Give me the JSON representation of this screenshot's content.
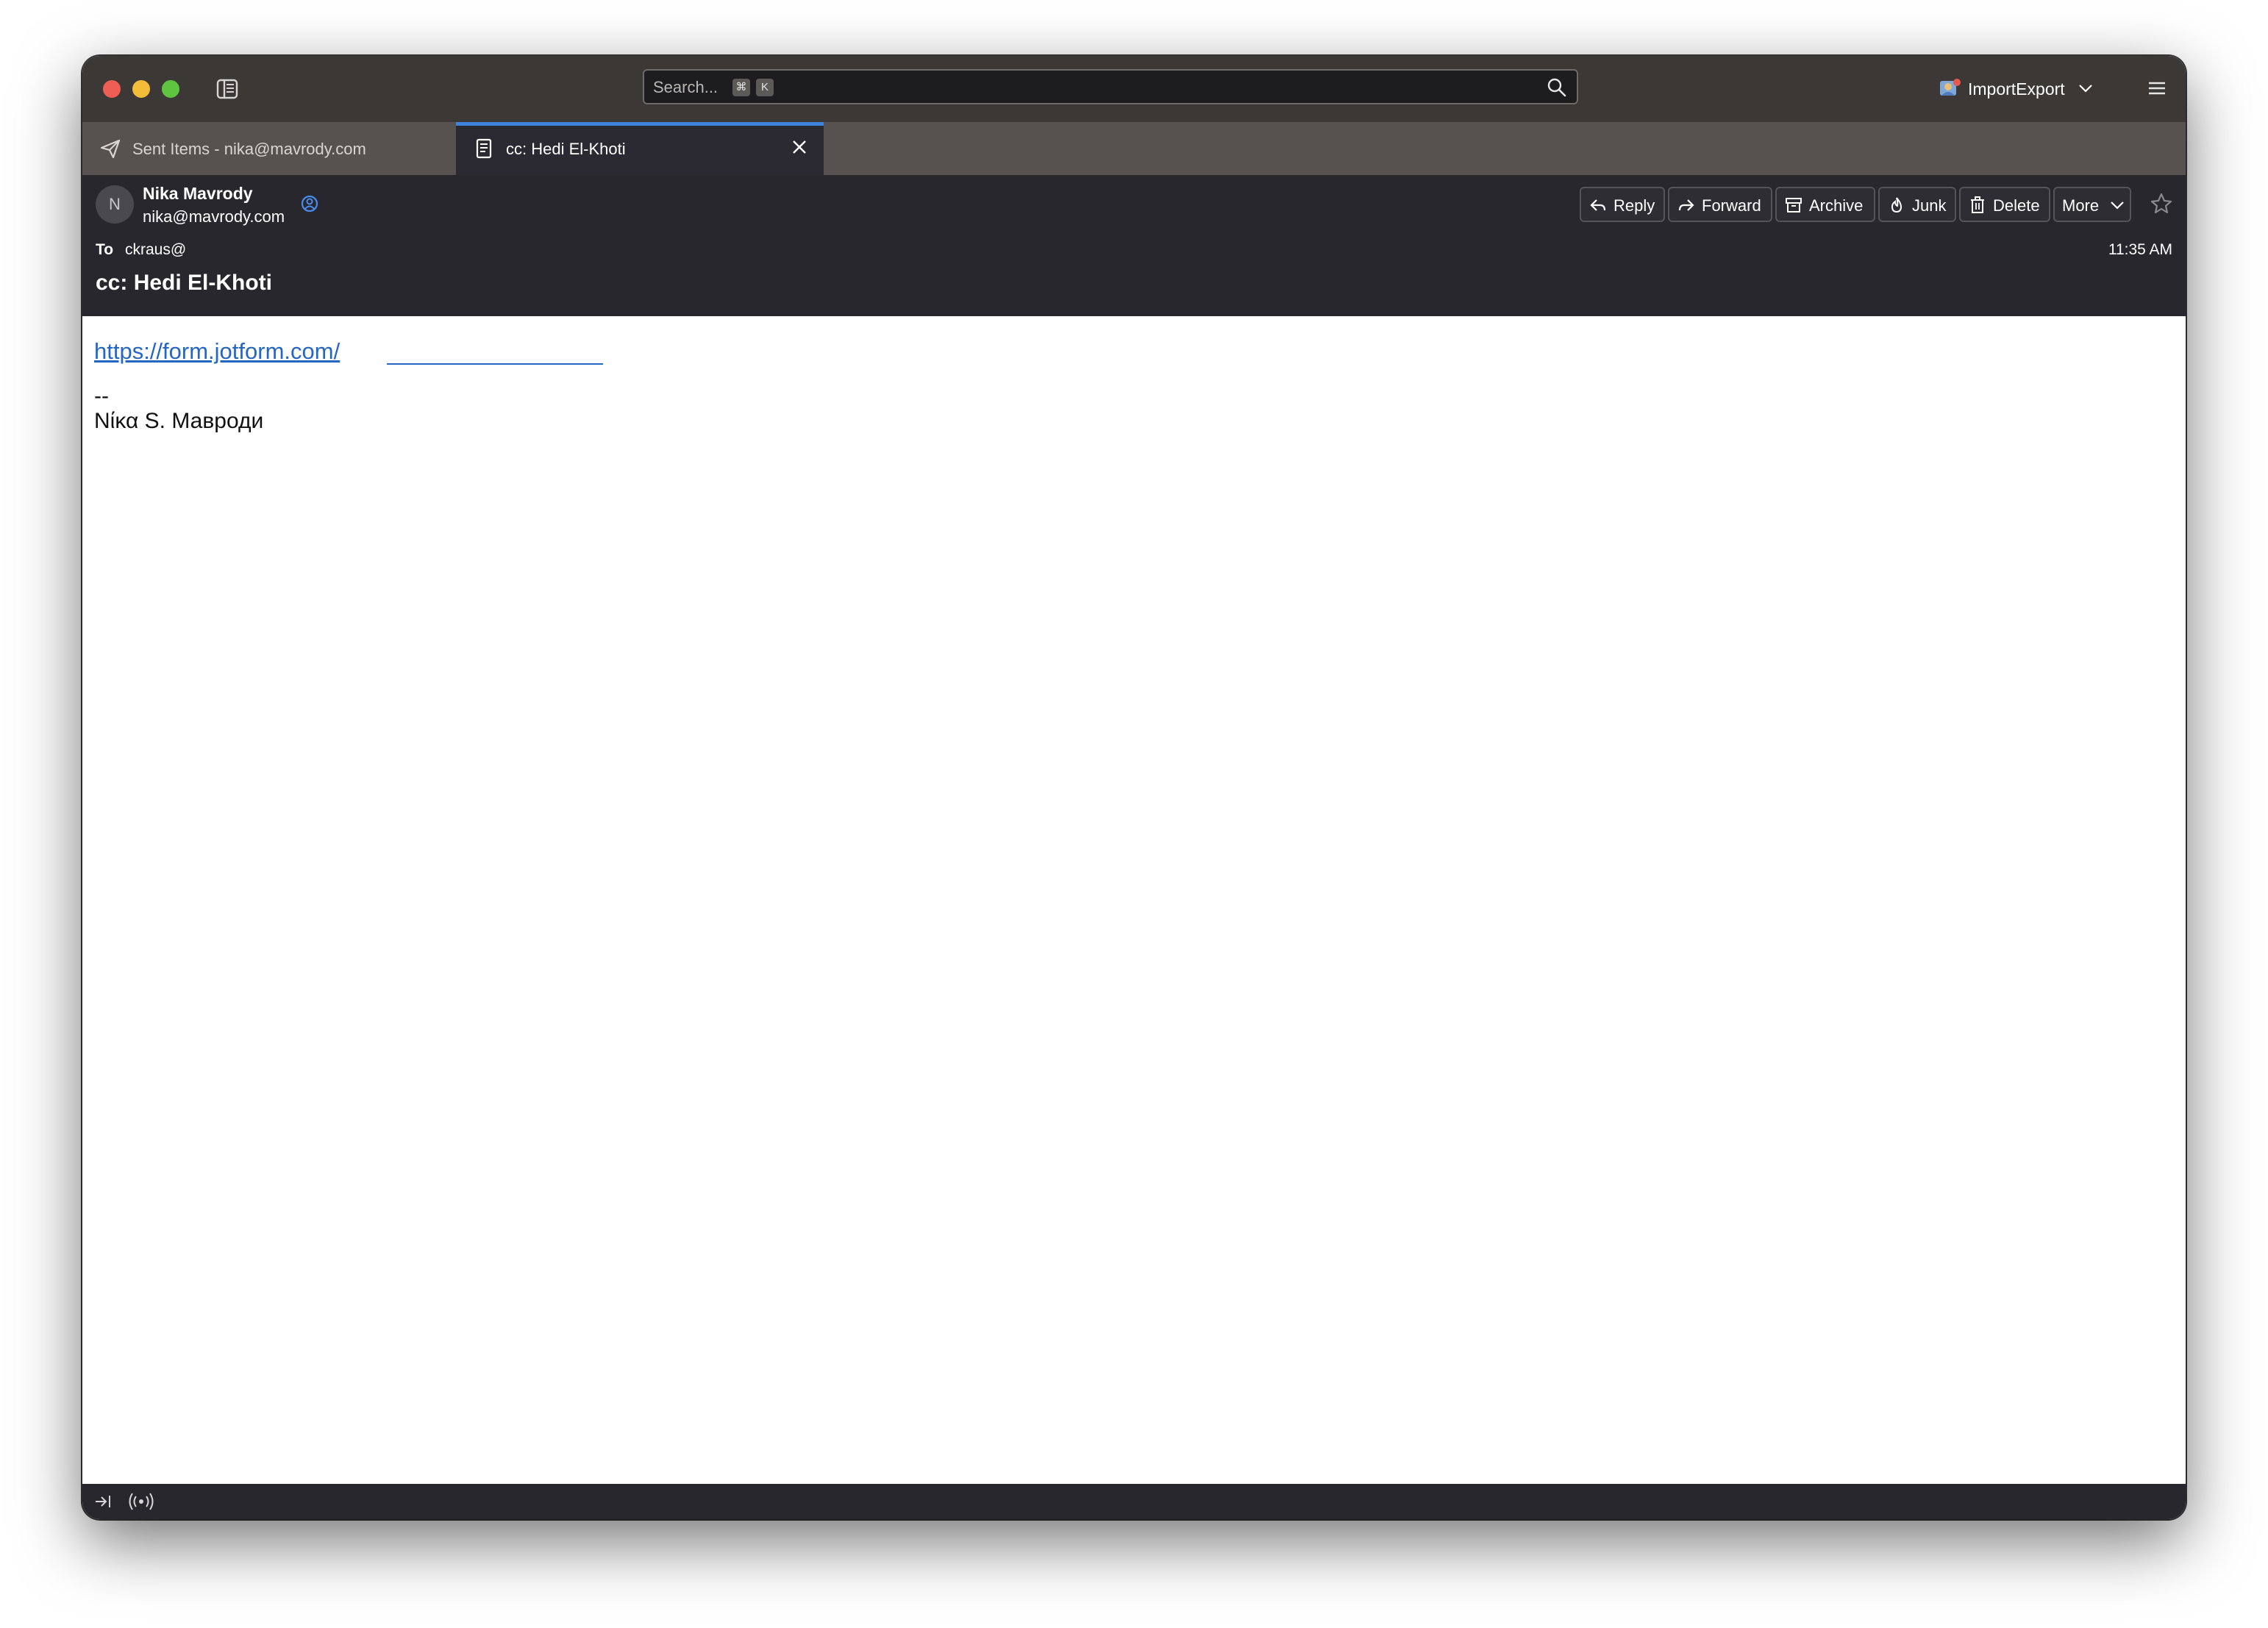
{
  "toolbar": {
    "search_placeholder": "Search...",
    "kbd_cmd": "⌘",
    "kbd_key": "K",
    "account_label": "ImportExport"
  },
  "tabs": [
    {
      "label": "Sent Items - nika@mavrody.com",
      "icon": "paper-plane-icon",
      "active": false
    },
    {
      "label": "cc: Hedi El-Khoti",
      "icon": "message-icon",
      "active": true
    }
  ],
  "message": {
    "avatar_initial": "N",
    "from_name": "Nika Mavrody",
    "from_email": "nika@mavrody.com",
    "to_label": "To",
    "to_value": "ckraus@",
    "time": "11:35 AM",
    "subject": "cc: Hedi El-Khoti",
    "actions": {
      "reply": "Reply",
      "forward": "Forward",
      "archive": "Archive",
      "junk": "Junk",
      "delete": "Delete",
      "more": "More"
    }
  },
  "body": {
    "link": "https://form.jotform.com/",
    "signature_separator": "--",
    "signature_name": "Νίκα S. Мавроди"
  },
  "colors": {
    "titlebar": "#3b3836",
    "tabbar": "#57524f",
    "header": "#28272d",
    "accent": "#3f82dc",
    "link": "#2366c4"
  }
}
